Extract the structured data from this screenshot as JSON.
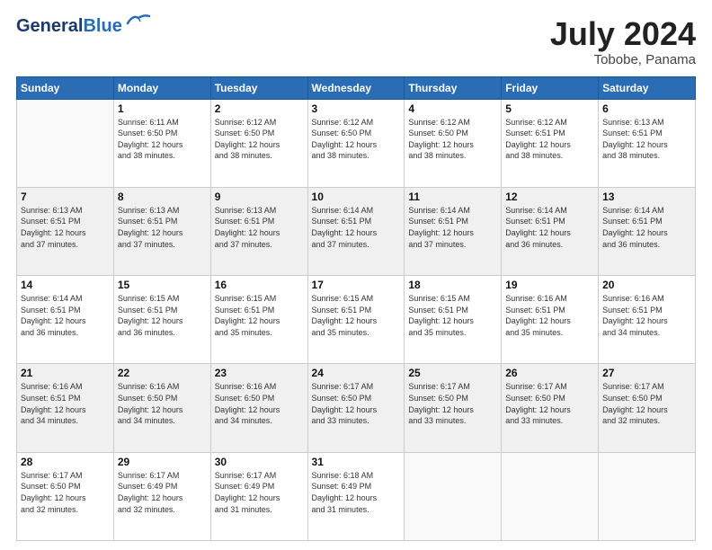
{
  "header": {
    "logo_line1": "General",
    "logo_line2": "Blue",
    "month": "July 2024",
    "location": "Tobobe, Panama"
  },
  "weekdays": [
    "Sunday",
    "Monday",
    "Tuesday",
    "Wednesday",
    "Thursday",
    "Friday",
    "Saturday"
  ],
  "weeks": [
    [
      {
        "day": "",
        "info": ""
      },
      {
        "day": "1",
        "info": "Sunrise: 6:11 AM\nSunset: 6:50 PM\nDaylight: 12 hours\nand 38 minutes."
      },
      {
        "day": "2",
        "info": "Sunrise: 6:12 AM\nSunset: 6:50 PM\nDaylight: 12 hours\nand 38 minutes."
      },
      {
        "day": "3",
        "info": "Sunrise: 6:12 AM\nSunset: 6:50 PM\nDaylight: 12 hours\nand 38 minutes."
      },
      {
        "day": "4",
        "info": "Sunrise: 6:12 AM\nSunset: 6:50 PM\nDaylight: 12 hours\nand 38 minutes."
      },
      {
        "day": "5",
        "info": "Sunrise: 6:12 AM\nSunset: 6:51 PM\nDaylight: 12 hours\nand 38 minutes."
      },
      {
        "day": "6",
        "info": "Sunrise: 6:13 AM\nSunset: 6:51 PM\nDaylight: 12 hours\nand 38 minutes."
      }
    ],
    [
      {
        "day": "7",
        "info": "Sunrise: 6:13 AM\nSunset: 6:51 PM\nDaylight: 12 hours\nand 37 minutes."
      },
      {
        "day": "8",
        "info": "Sunrise: 6:13 AM\nSunset: 6:51 PM\nDaylight: 12 hours\nand 37 minutes."
      },
      {
        "day": "9",
        "info": "Sunrise: 6:13 AM\nSunset: 6:51 PM\nDaylight: 12 hours\nand 37 minutes."
      },
      {
        "day": "10",
        "info": "Sunrise: 6:14 AM\nSunset: 6:51 PM\nDaylight: 12 hours\nand 37 minutes."
      },
      {
        "day": "11",
        "info": "Sunrise: 6:14 AM\nSunset: 6:51 PM\nDaylight: 12 hours\nand 37 minutes."
      },
      {
        "day": "12",
        "info": "Sunrise: 6:14 AM\nSunset: 6:51 PM\nDaylight: 12 hours\nand 36 minutes."
      },
      {
        "day": "13",
        "info": "Sunrise: 6:14 AM\nSunset: 6:51 PM\nDaylight: 12 hours\nand 36 minutes."
      }
    ],
    [
      {
        "day": "14",
        "info": "Sunrise: 6:14 AM\nSunset: 6:51 PM\nDaylight: 12 hours\nand 36 minutes."
      },
      {
        "day": "15",
        "info": "Sunrise: 6:15 AM\nSunset: 6:51 PM\nDaylight: 12 hours\nand 36 minutes."
      },
      {
        "day": "16",
        "info": "Sunrise: 6:15 AM\nSunset: 6:51 PM\nDaylight: 12 hours\nand 35 minutes."
      },
      {
        "day": "17",
        "info": "Sunrise: 6:15 AM\nSunset: 6:51 PM\nDaylight: 12 hours\nand 35 minutes."
      },
      {
        "day": "18",
        "info": "Sunrise: 6:15 AM\nSunset: 6:51 PM\nDaylight: 12 hours\nand 35 minutes."
      },
      {
        "day": "19",
        "info": "Sunrise: 6:16 AM\nSunset: 6:51 PM\nDaylight: 12 hours\nand 35 minutes."
      },
      {
        "day": "20",
        "info": "Sunrise: 6:16 AM\nSunset: 6:51 PM\nDaylight: 12 hours\nand 34 minutes."
      }
    ],
    [
      {
        "day": "21",
        "info": "Sunrise: 6:16 AM\nSunset: 6:51 PM\nDaylight: 12 hours\nand 34 minutes."
      },
      {
        "day": "22",
        "info": "Sunrise: 6:16 AM\nSunset: 6:50 PM\nDaylight: 12 hours\nand 34 minutes."
      },
      {
        "day": "23",
        "info": "Sunrise: 6:16 AM\nSunset: 6:50 PM\nDaylight: 12 hours\nand 34 minutes."
      },
      {
        "day": "24",
        "info": "Sunrise: 6:17 AM\nSunset: 6:50 PM\nDaylight: 12 hours\nand 33 minutes."
      },
      {
        "day": "25",
        "info": "Sunrise: 6:17 AM\nSunset: 6:50 PM\nDaylight: 12 hours\nand 33 minutes."
      },
      {
        "day": "26",
        "info": "Sunrise: 6:17 AM\nSunset: 6:50 PM\nDaylight: 12 hours\nand 33 minutes."
      },
      {
        "day": "27",
        "info": "Sunrise: 6:17 AM\nSunset: 6:50 PM\nDaylight: 12 hours\nand 32 minutes."
      }
    ],
    [
      {
        "day": "28",
        "info": "Sunrise: 6:17 AM\nSunset: 6:50 PM\nDaylight: 12 hours\nand 32 minutes."
      },
      {
        "day": "29",
        "info": "Sunrise: 6:17 AM\nSunset: 6:49 PM\nDaylight: 12 hours\nand 32 minutes."
      },
      {
        "day": "30",
        "info": "Sunrise: 6:17 AM\nSunset: 6:49 PM\nDaylight: 12 hours\nand 31 minutes."
      },
      {
        "day": "31",
        "info": "Sunrise: 6:18 AM\nSunset: 6:49 PM\nDaylight: 12 hours\nand 31 minutes."
      },
      {
        "day": "",
        "info": ""
      },
      {
        "day": "",
        "info": ""
      },
      {
        "day": "",
        "info": ""
      }
    ]
  ]
}
